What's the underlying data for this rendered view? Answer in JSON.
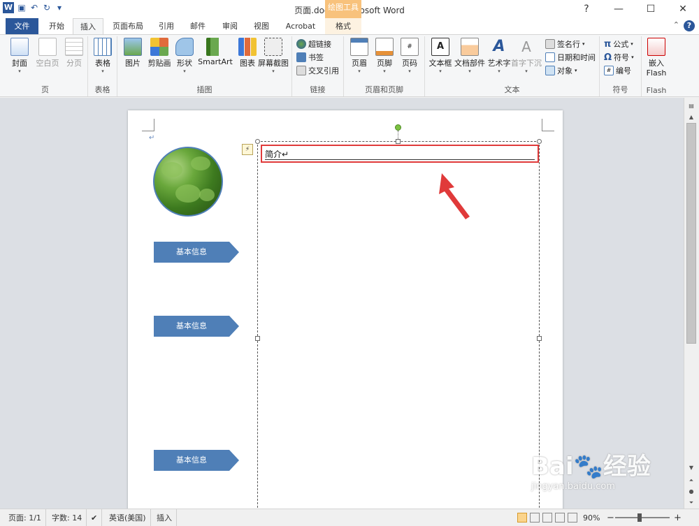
{
  "window": {
    "title": "页面.docx - Microsoft Word",
    "context_tab_group": "绘图工具"
  },
  "tabs": [
    "文件",
    "开始",
    "插入",
    "页面布局",
    "引用",
    "邮件",
    "审阅",
    "视图",
    "Acrobat",
    "格式"
  ],
  "ribbon": {
    "groups": {
      "page": "页",
      "table": "表格",
      "illustrations": "插图",
      "links": "链接",
      "header_footer": "页眉和页脚",
      "text": "文本",
      "symbols": "符号",
      "flash": "Flash"
    },
    "buttons": {
      "cover": "封面",
      "blank_page": "空白页",
      "page_break": "分页",
      "table": "表格",
      "picture": "图片",
      "clipart": "剪贴画",
      "shapes": "形状",
      "smartart": "SmartArt",
      "chart": "图表",
      "screenshot": "屏幕截图",
      "hyperlink": "超链接",
      "bookmark": "书签",
      "crossref": "交叉引用",
      "header": "页眉",
      "footer": "页脚",
      "page_number": "页码",
      "textbox": "文本框",
      "quickparts": "文档部件",
      "wordart": "艺术字",
      "dropcap": "首字下沉",
      "signature": "签名行",
      "datetime": "日期和时间",
      "object": "对象",
      "equation": "公式",
      "symbol": "符号",
      "numbering": "编号",
      "embed_flash_1": "嵌入",
      "embed_flash_2": "Flash"
    }
  },
  "document": {
    "paragraph_mark": "↵",
    "tag1": "基本信息",
    "tag2": "基本信息",
    "tag3": "基本信息",
    "textbox_title": "简介↵"
  },
  "status": {
    "page": "页面: 1/1",
    "words": "字数: 14",
    "language": "英语(美国)",
    "mode": "插入",
    "zoom": "90%"
  },
  "watermark": {
    "brand": "Bai",
    "brand2": "经验",
    "url": "jingyan.baidu.com"
  },
  "colors": {
    "accent": "#2b579a",
    "tag": "#4f7fb7",
    "highlight": "#e03a3a",
    "context": "#f8c27c"
  }
}
